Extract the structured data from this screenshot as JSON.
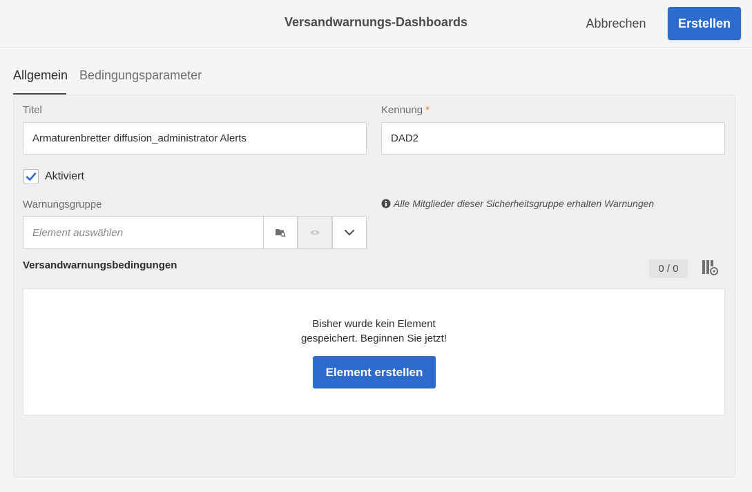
{
  "header": {
    "title": "Versandwarnungs-Dashboards",
    "cancel_label": "Abbrechen",
    "create_label": "Erstellen"
  },
  "tabs": [
    {
      "label": "Allgemein",
      "active": true
    },
    {
      "label": "Bedingungsparameter",
      "active": false
    }
  ],
  "form": {
    "title_label": "Titel",
    "title_value": "Armaturenbretter diffusion_administrator Alerts",
    "id_label": "Kennung",
    "id_required_mark": "*",
    "id_value": "DAD2",
    "active_label": "Aktiviert",
    "active_checked": true,
    "group_label": "Warnungsgruppe",
    "group_placeholder": "Element auswählen",
    "group_note": "Alle Mitglieder dieser Sicherheitsgruppe erhalten Warnungen"
  },
  "conditions": {
    "title": "Versandwarnungsbedingungen",
    "counter": "0 / 0",
    "empty_line1": "Bisher wurde kein Element",
    "empty_line2": "gespeichert. Beginnen Sie jetzt!",
    "add_label": "Element erstellen"
  },
  "colors": {
    "primary": "#2d6bcf",
    "required": "#e68619",
    "checkbox": "#2d6bcf"
  },
  "icons": {
    "folder_picker": "folder-search-icon",
    "preview": "eye-icon",
    "dropdown": "chevron-down-icon",
    "info": "info-icon",
    "columns_settings": "columns-settings-icon",
    "checkmark": "checkmark-icon"
  }
}
